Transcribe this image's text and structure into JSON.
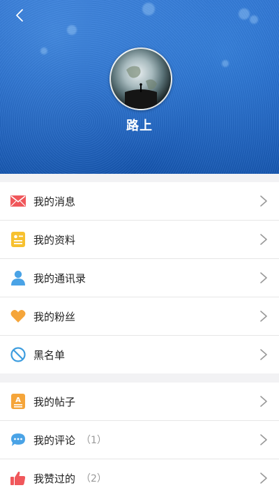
{
  "profile": {
    "username": "路上",
    "avatar_icon": "earth-avatar"
  },
  "nav": {
    "back_icon": "chevron-left-icon"
  },
  "menu_group_1": [
    {
      "label": "我的消息",
      "icon": "mail-icon",
      "color": "#f0575b"
    },
    {
      "label": "我的资料",
      "icon": "profile-card-icon",
      "color": "#f7c12f"
    },
    {
      "label": "我的通讯录",
      "icon": "contacts-icon",
      "color": "#4aa3e6"
    },
    {
      "label": "我的粉丝",
      "icon": "heart-icon",
      "color": "#f5a53a"
    },
    {
      "label": "黑名单",
      "icon": "block-icon",
      "color": "#3d9ddf"
    }
  ],
  "menu_group_2": [
    {
      "label": "我的帖子",
      "icon": "post-icon",
      "color": "#f5a53a",
      "count": ""
    },
    {
      "label": "我的评论",
      "icon": "comment-icon",
      "color": "#4aa3e6",
      "count": "（1）"
    },
    {
      "label": "我赞过的",
      "icon": "thumbs-up-icon",
      "color": "#f0575b",
      "count": "（2）"
    }
  ],
  "colors": {
    "header_blue": "#1e63c5",
    "chevron": "#999999"
  }
}
